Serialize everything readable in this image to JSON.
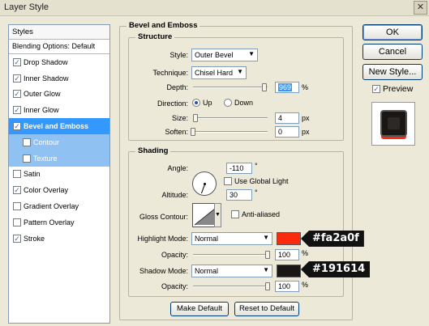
{
  "window": {
    "title": "Layer Style",
    "close_glyph": "✕"
  },
  "styles_panel": {
    "header": "Styles",
    "blending_options": "Blending Options: Default",
    "items": [
      {
        "label": "Drop Shadow",
        "checked": true
      },
      {
        "label": "Inner Shadow",
        "checked": true
      },
      {
        "label": "Outer Glow",
        "checked": true
      },
      {
        "label": "Inner Glow",
        "checked": true
      },
      {
        "label": "Bevel and Emboss",
        "checked": true,
        "selected": true
      },
      {
        "label": "Contour",
        "checked": false,
        "sub": true
      },
      {
        "label": "Texture",
        "checked": false,
        "sub": true
      },
      {
        "label": "Satin",
        "checked": false
      },
      {
        "label": "Color Overlay",
        "checked": true
      },
      {
        "label": "Gradient Overlay",
        "checked": false
      },
      {
        "label": "Pattern Overlay",
        "checked": false
      },
      {
        "label": "Stroke",
        "checked": true
      }
    ]
  },
  "bevel": {
    "title": "Bevel and Emboss",
    "structure": {
      "title": "Structure",
      "style_label": "Style:",
      "style_value": "Outer Bevel",
      "technique_label": "Technique:",
      "technique_value": "Chisel Hard",
      "depth_label": "Depth:",
      "depth_value": "969",
      "depth_unit": "%",
      "depth_slider": 0.96,
      "direction_label": "Direction:",
      "direction_up": "Up",
      "direction_down": "Down",
      "direction_selected": "Up",
      "size_label": "Size:",
      "size_value": "4",
      "size_unit": "px",
      "size_slider": 0.03,
      "soften_label": "Soften:",
      "soften_value": "0",
      "soften_unit": "px",
      "soften_slider": 0.0
    },
    "shading": {
      "title": "Shading",
      "angle_label": "Angle:",
      "angle_value": "-110",
      "angle_unit": "°",
      "global_light_label": "Use Global Light",
      "global_light": false,
      "altitude_label": "Altitude:",
      "altitude_value": "30",
      "altitude_unit": "°",
      "gloss_contour_label": "Gloss Contour:",
      "anti_aliased_label": "Anti-aliased",
      "anti_aliased": false,
      "highlight_mode_label": "Highlight Mode:",
      "highlight_mode_value": "Normal",
      "highlight_color": "#fa2a0f",
      "highlight_hex_label": "#fa2a0f",
      "highlight_opacity_label": "Opacity:",
      "highlight_opacity_value": "100",
      "highlight_opacity_unit": "%",
      "highlight_opacity_slider": 1.0,
      "shadow_mode_label": "Shadow Mode:",
      "shadow_mode_value": "Normal",
      "shadow_color": "#191614",
      "shadow_hex_label": "#191614",
      "shadow_opacity_label": "Opacity:",
      "shadow_opacity_value": "100",
      "shadow_opacity_unit": "%",
      "shadow_opacity_slider": 1.0
    },
    "make_default": "Make Default",
    "reset_default": "Reset to Default"
  },
  "actions": {
    "ok": "OK",
    "cancel": "Cancel",
    "new_style": "New Style...",
    "preview_label": "Preview",
    "preview": true
  }
}
